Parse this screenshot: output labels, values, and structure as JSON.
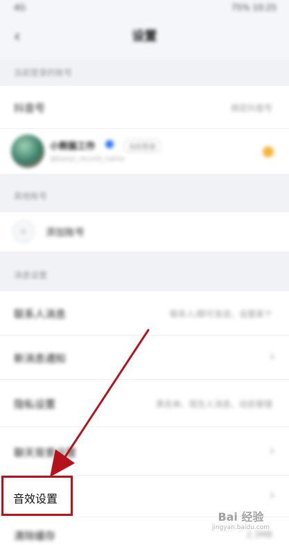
{
  "status_bar": {
    "left": "4G",
    "right": "75% 10:25"
  },
  "nav": {
    "title": "设置"
  },
  "sections": {
    "current_account": "当前登录的账号",
    "other_accounts": "其他账号",
    "message": "消息设置"
  },
  "rows": {
    "douyin_id": {
      "label": "抖音号",
      "value": "绑定抖音号"
    },
    "account": {
      "name": "小熊猫工作",
      "tag": "当前登录",
      "sub": "@baoyi_record_name"
    },
    "add_account": {
      "label": "添加账号"
    },
    "contacts_video": {
      "label": "联系人消息",
      "value": "联系人/群可发送，设置某个"
    },
    "new_message": {
      "label": "新消息通知"
    },
    "privacy": {
      "label": "隐私设置",
      "value": "黑名单、陌生人消息、动态管理"
    },
    "chat_bg": {
      "label": "聊天背景设置"
    },
    "audio": {
      "label": "音效设置"
    },
    "cache": {
      "label": "清除缓存",
      "value": "2.3MB"
    }
  },
  "watermark": {
    "main": "Bai 经验",
    "sub": "jingyan.baidu.com"
  },
  "colors": {
    "annotation_red": "#b5121b",
    "accent_blue": "#2f7cf6",
    "badge_orange": "#f5b53d"
  }
}
